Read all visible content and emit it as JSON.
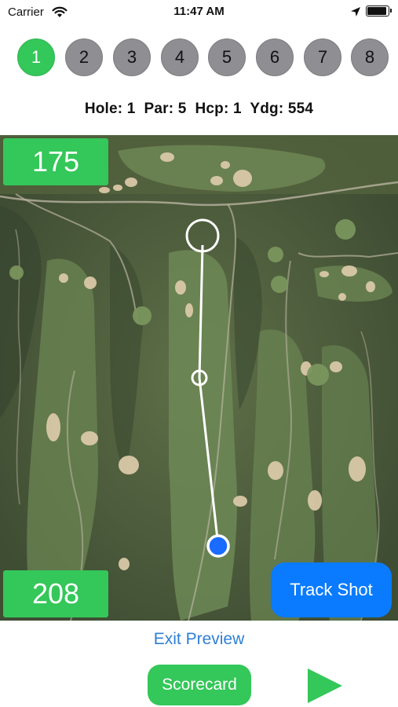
{
  "status": {
    "carrier": "Carrier",
    "time": "11:47 AM"
  },
  "holes": [
    {
      "label": "1",
      "active": true
    },
    {
      "label": "2",
      "active": false
    },
    {
      "label": "3",
      "active": false
    },
    {
      "label": "4",
      "active": false
    },
    {
      "label": "5",
      "active": false
    },
    {
      "label": "6",
      "active": false
    },
    {
      "label": "7",
      "active": false
    },
    {
      "label": "8",
      "active": false
    }
  ],
  "hole_info": {
    "text": "Hole: 1  Par: 5  Hcp: 1  Ydg: 554"
  },
  "map": {
    "distance_top": "175",
    "distance_bottom": "208"
  },
  "actions": {
    "track_shot": "Track Shot",
    "exit_preview": "Exit Preview",
    "scorecard": "Scorecard"
  },
  "colors": {
    "accent_green": "#34c759",
    "accent_blue": "#0a7bff",
    "link_blue": "#2f7fd6",
    "inactive_gray": "#8e8e93"
  },
  "icons": [
    "wifi-icon",
    "location-arrow-icon",
    "battery-icon",
    "play-icon"
  ]
}
